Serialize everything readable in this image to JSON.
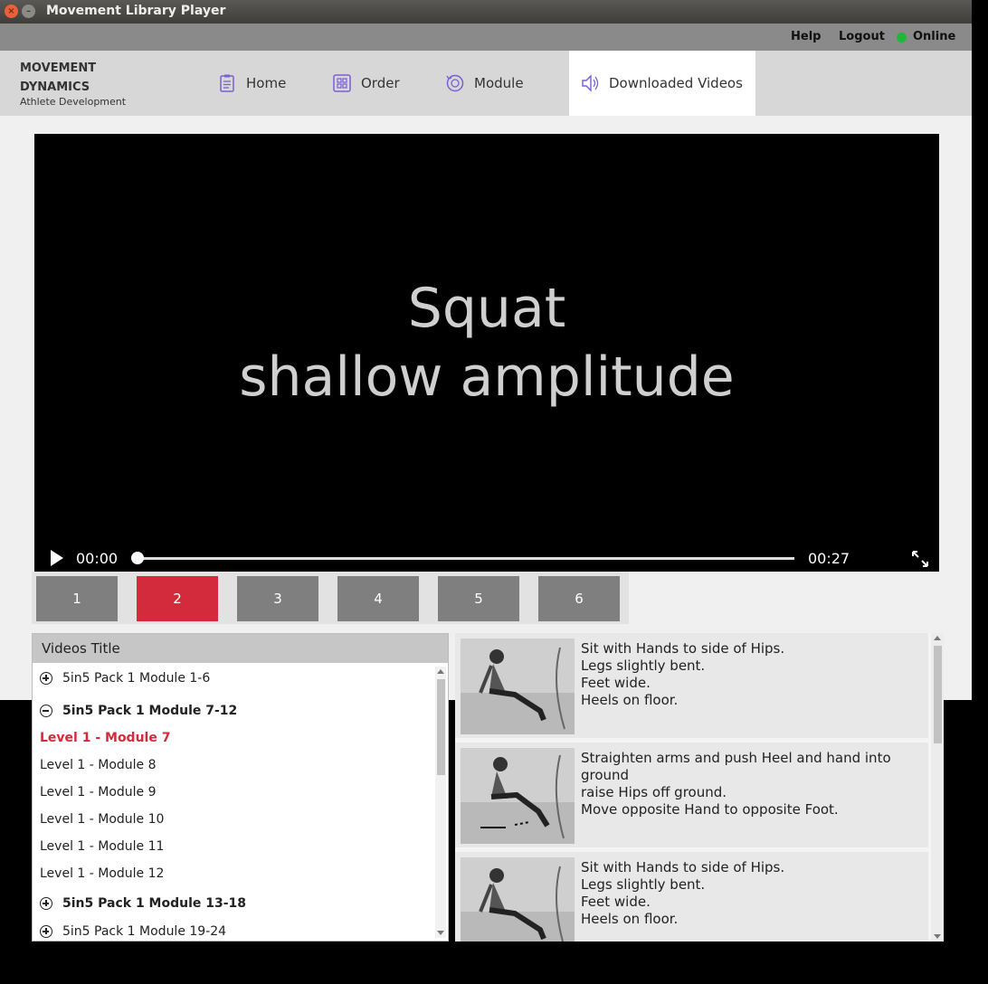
{
  "window": {
    "title": "Movement Library Player"
  },
  "topbar": {
    "help": "Help",
    "logout": "Logout",
    "status": "Online",
    "status_color": "#1fb83a"
  },
  "brand": {
    "line1": "MOVEMENT",
    "line2": "DYNAMICS",
    "sub": "Athlete Development"
  },
  "nav": [
    {
      "label": "Home",
      "icon": "clipboard-icon"
    },
    {
      "label": "Order",
      "icon": "grid-icon"
    },
    {
      "label": "Module",
      "icon": "cycle-icon"
    },
    {
      "label": "Downloaded Videos",
      "icon": "speaker-icon",
      "active": true
    }
  ],
  "video": {
    "line1": "Squat",
    "line2": "shallow amplitude",
    "current_time": "00:00",
    "duration": "00:27",
    "progress": 0
  },
  "pages": {
    "items": [
      "1",
      "2",
      "3",
      "4",
      "5",
      "6"
    ],
    "selected": "2",
    "accent": "#d42b3c"
  },
  "list": {
    "header": "Videos Title",
    "rows": [
      {
        "label": "5in5 Pack 1 Module 1-6",
        "type": "group-collapsed"
      },
      {
        "label": "5in5 Pack 1 Module 7-12",
        "type": "group-expanded"
      },
      {
        "label": "Level 1 - Module 7",
        "type": "item-selected"
      },
      {
        "label": "Level 1 - Module 8",
        "type": "item"
      },
      {
        "label": "Level 1 - Module 9",
        "type": "item"
      },
      {
        "label": "Level 1 - Module 10",
        "type": "item"
      },
      {
        "label": "Level 1 - Module 11",
        "type": "item"
      },
      {
        "label": "Level 1 - Module 12",
        "type": "item"
      },
      {
        "label": "5in5 Pack 1 Module 13-18",
        "type": "group-collapsed-bold"
      },
      {
        "label": "5in5 Pack 1 Module 19-24",
        "type": "group-collapsed"
      }
    ]
  },
  "instructions": [
    {
      "text": "Sit with Hands to side of Hips.\nLegs slightly bent.\nFeet wide.\nHeels on floor."
    },
    {
      "text": "Straighten arms and push Heel and hand into ground\nraise Hips off ground.\nMove opposite Hand to opposite Foot."
    },
    {
      "text": "Sit with Hands to side of Hips.\nLegs slightly bent.\nFeet wide.\nHeels on floor."
    }
  ]
}
